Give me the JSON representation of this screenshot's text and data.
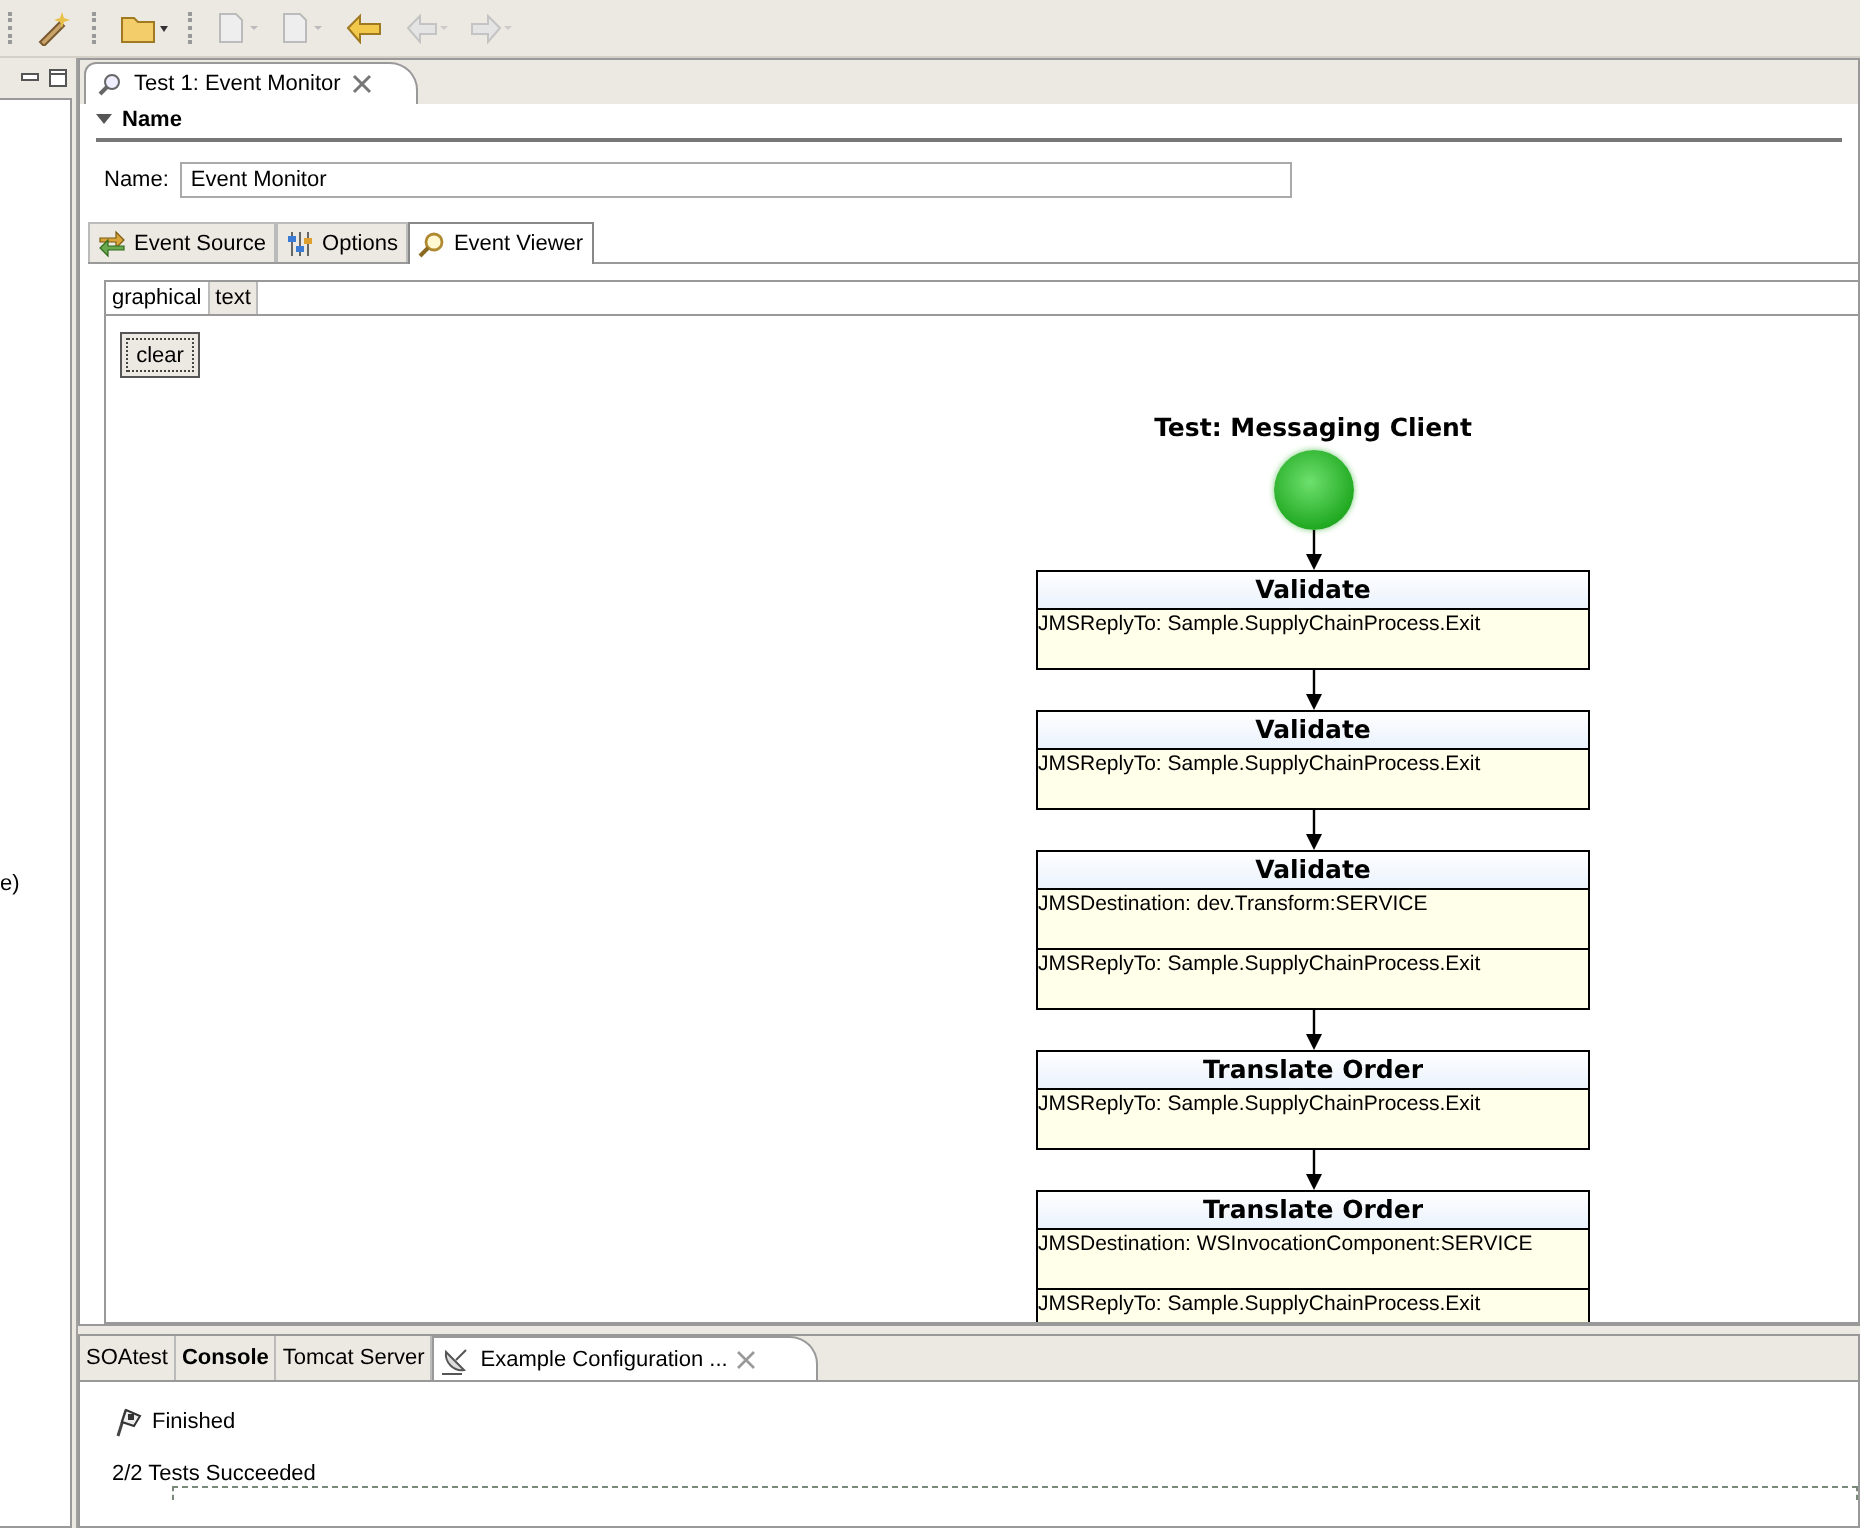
{
  "left_panel": {
    "text_fragment": "e)"
  },
  "editor_tab": {
    "title": "Test 1: Event Monitor",
    "selected": true
  },
  "section": {
    "title": "Name",
    "expanded": true
  },
  "name_field": {
    "label": "Name:",
    "value": "Event Monitor"
  },
  "tabs": [
    {
      "label": "Event Source",
      "kind": "source",
      "selected": false
    },
    {
      "label": "Options",
      "kind": "options",
      "selected": false
    },
    {
      "label": "Event Viewer",
      "kind": "viewer",
      "selected": true
    }
  ],
  "view_tabs": [
    {
      "label": "graphical",
      "selected": true
    },
    {
      "label": "text",
      "selected": false
    }
  ],
  "clear_button": "clear",
  "diagram": {
    "title": "Test: Messaging Client",
    "nodes": [
      {
        "title": "Validate",
        "sections": [
          "JMSReplyTo: Sample.SupplyChainProcess.Exit"
        ]
      },
      {
        "title": "Validate",
        "sections": [
          "JMSReplyTo: Sample.SupplyChainProcess.Exit"
        ]
      },
      {
        "title": "Validate",
        "sections": [
          "JMSDestination: dev.Transform:SERVICE",
          "JMSReplyTo: Sample.SupplyChainProcess.Exit"
        ]
      },
      {
        "title": "Translate Order",
        "sections": [
          "JMSReplyTo: Sample.SupplyChainProcess.Exit"
        ]
      },
      {
        "title": "Translate Order",
        "sections": [
          "JMSDestination: WSInvocationComponent:SERVICE",
          "JMSReplyTo: Sample.SupplyChainProcess.Exit"
        ]
      }
    ]
  },
  "bottom_tabs": [
    {
      "label": "SOAtest",
      "emphasized": false,
      "selected": false
    },
    {
      "label": "Console",
      "emphasized": true,
      "selected": false
    },
    {
      "label": "Tomcat Server",
      "emphasized": false,
      "selected": false
    },
    {
      "label": "Example Configuration ...",
      "emphasized": false,
      "selected": true,
      "closable": true
    }
  ],
  "console": {
    "status": "Finished",
    "summary": "2/2 Tests Succeeded"
  }
}
